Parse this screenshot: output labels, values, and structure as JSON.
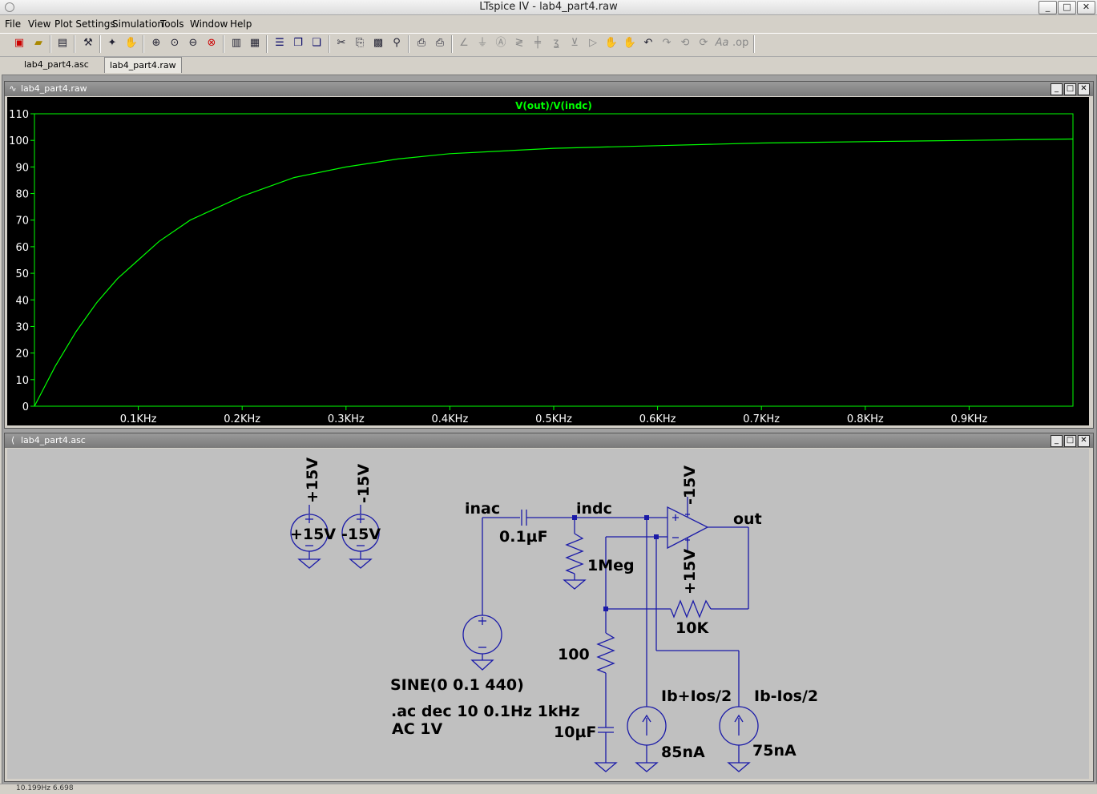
{
  "window": {
    "title": "LTspice IV - lab4_part4.raw",
    "minimize": "_",
    "maximize": "□",
    "close": "✕"
  },
  "menu": [
    "File",
    "View",
    "Plot Settings",
    "Simulation",
    "Tools",
    "Window",
    "Help"
  ],
  "tabs": [
    {
      "label": "lab4_part4.asc"
    },
    {
      "label": "lab4_part4.raw"
    }
  ],
  "waveform": {
    "title": "lab4_part4.raw",
    "chart_data": {
      "type": "line",
      "title": "V(out)/V(indc)",
      "series": [
        {
          "name": "V(out)/V(indc)",
          "x": [
            0,
            20,
            40,
            60,
            80,
            100,
            120,
            150,
            200,
            250,
            300,
            350,
            400,
            450,
            500,
            600,
            700,
            800,
            900,
            1000
          ],
          "values": [
            0,
            15,
            28,
            39,
            48,
            55,
            62,
            70,
            79,
            86,
            90,
            93,
            95,
            96,
            97,
            98,
            99,
            99.5,
            100,
            100.5
          ]
        }
      ],
      "xlim": [
        0,
        1000
      ],
      "ylim": [
        0,
        110
      ],
      "yticks": [
        "0",
        "10",
        "20",
        "30",
        "40",
        "50",
        "60",
        "70",
        "80",
        "90",
        "100",
        "110"
      ],
      "xticks": [
        "0.1KHz",
        "0.2KHz",
        "0.3KHz",
        "0.4KHz",
        "0.5KHz",
        "0.6KHz",
        "0.7KHz",
        "0.8KHz",
        "0.9KHz"
      ],
      "colors": {
        "background": "#000000",
        "trace": "#00ff00",
        "grid": "#00ff00",
        "text": "#ffffff"
      }
    }
  },
  "schematic": {
    "title": "lab4_part4.asc",
    "labels": {
      "v1_top": "+15V",
      "v1_val": "+15V",
      "v2_top": "-15V",
      "v2_val": "-15V",
      "inac": "inac",
      "cap1": "0.1µF",
      "indc": "indc",
      "r1": "1Meg",
      "opamp_neg": "-15V",
      "opamp_pos": "+15V",
      "out": "out",
      "rf": "10K",
      "rg": "100",
      "sine": "SINE(0 0.1 440)",
      "ac_cmd": ".ac dec 10 0.1Hz 1kHz",
      "ac_amp": "AC 1V",
      "cap2": "10µF",
      "i1_name": "Ib+Ios/2",
      "i1_val": "85nA",
      "i2_name": "Ib-Ios/2",
      "i2_val": "75nA"
    }
  },
  "status": {
    "text": "10.199Hz   6.698"
  }
}
